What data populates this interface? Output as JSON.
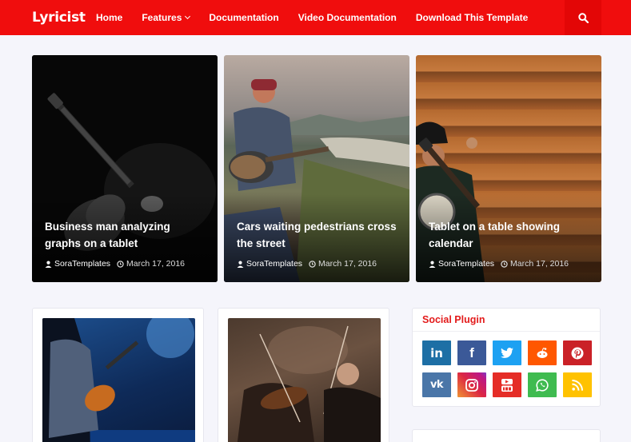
{
  "header": {
    "logo": "Lyricist",
    "nav": [
      "Home",
      "Features",
      "Documentation",
      "Video Documentation",
      "Download This Template"
    ]
  },
  "featured": [
    {
      "title": "Business man analyzing graphs on a tablet",
      "author": "SoraTemplates",
      "date": "March 17, 2016"
    },
    {
      "title": "Cars waiting pedestrians cross the street",
      "author": "SoraTemplates",
      "date": "March 17, 2016"
    },
    {
      "title": "Tablet on a table showing calendar",
      "author": "SoraTemplates",
      "date": "March 17, 2016"
    }
  ],
  "widget": {
    "title": "Social Plugin",
    "icons": [
      {
        "name": "linkedin-icon",
        "glyph": "in",
        "color": "#1d6fa5"
      },
      {
        "name": "facebook-icon",
        "glyph": "f",
        "color": "#3b5998"
      },
      {
        "name": "twitter-icon",
        "glyph": "t",
        "color": "#1da1f2"
      },
      {
        "name": "reddit-icon",
        "glyph": "r",
        "color": "#ff5700"
      },
      {
        "name": "pinterest-icon",
        "glyph": "p",
        "color": "#ca2127"
      },
      {
        "name": "vk-icon",
        "glyph": "vk",
        "color": "#4a76a8"
      },
      {
        "name": "instagram-icon",
        "glyph": "ig",
        "color": "#c13584"
      },
      {
        "name": "youtube-icon",
        "glyph": "yt",
        "color": "#e52d27"
      },
      {
        "name": "whatsapp-icon",
        "glyph": "w",
        "color": "#3fbb50"
      },
      {
        "name": "rss-icon",
        "glyph": "rss",
        "color": "#ffc200"
      }
    ]
  },
  "colors": {
    "brand": "#f00d0d",
    "accent": "#e31b1b"
  }
}
